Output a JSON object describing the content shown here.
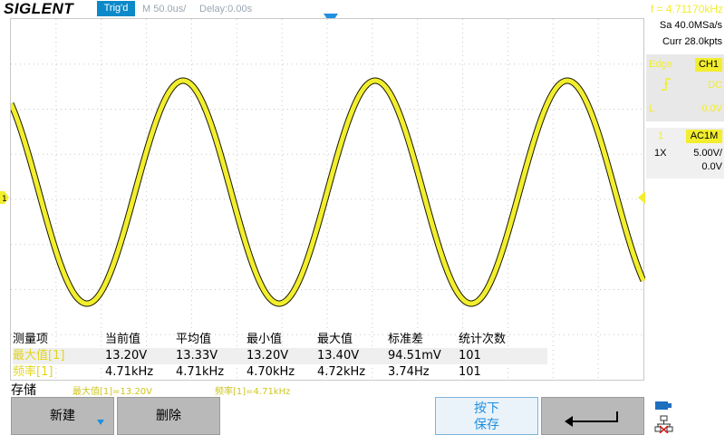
{
  "header": {
    "brand": "SIGLENT",
    "trigger_status": "Trig'd",
    "timebase": "M 50.0us/",
    "delay": "Delay:0.00s",
    "frequency": "f = 4.71170kHz"
  },
  "acquisition": {
    "sample_rate": "Sa 40.0MSa/s",
    "memory": "Curr 28.0kpts"
  },
  "trigger": {
    "type": "Edge",
    "source": "CH1",
    "coupling": "DC",
    "level_label": "L",
    "level": "0.0V"
  },
  "channel": {
    "number": "1",
    "coupling": "AC1M",
    "probe": "1X",
    "scale": "5.00V/",
    "offset": "0.0V",
    "trace_color": "#f2ee2e"
  },
  "measure": {
    "headers": [
      "测量项",
      "当前值",
      "平均值",
      "最小值",
      "最大值",
      "标准差",
      "统计次数"
    ],
    "rows": [
      [
        "最大值[1]",
        "13.20V",
        "13.33V",
        "13.20V",
        "13.40V",
        "94.51mV",
        "101"
      ],
      [
        "频率[1]",
        "4.71kHz",
        "4.71kHz",
        "4.70kHz",
        "4.72kHz",
        "3.74Hz",
        "101"
      ]
    ],
    "status_label": "存储",
    "status_items": [
      "最大值[1]=13.20V",
      "频率[1]=4.71kHz"
    ]
  },
  "softkeys": {
    "new": "新建",
    "delete": "删除",
    "press_save_line1": "按下",
    "press_save_line2": "保存"
  },
  "icons": {
    "return": "return-arrow-icon",
    "usb": "usb-icon",
    "network": "network-icon"
  }
}
